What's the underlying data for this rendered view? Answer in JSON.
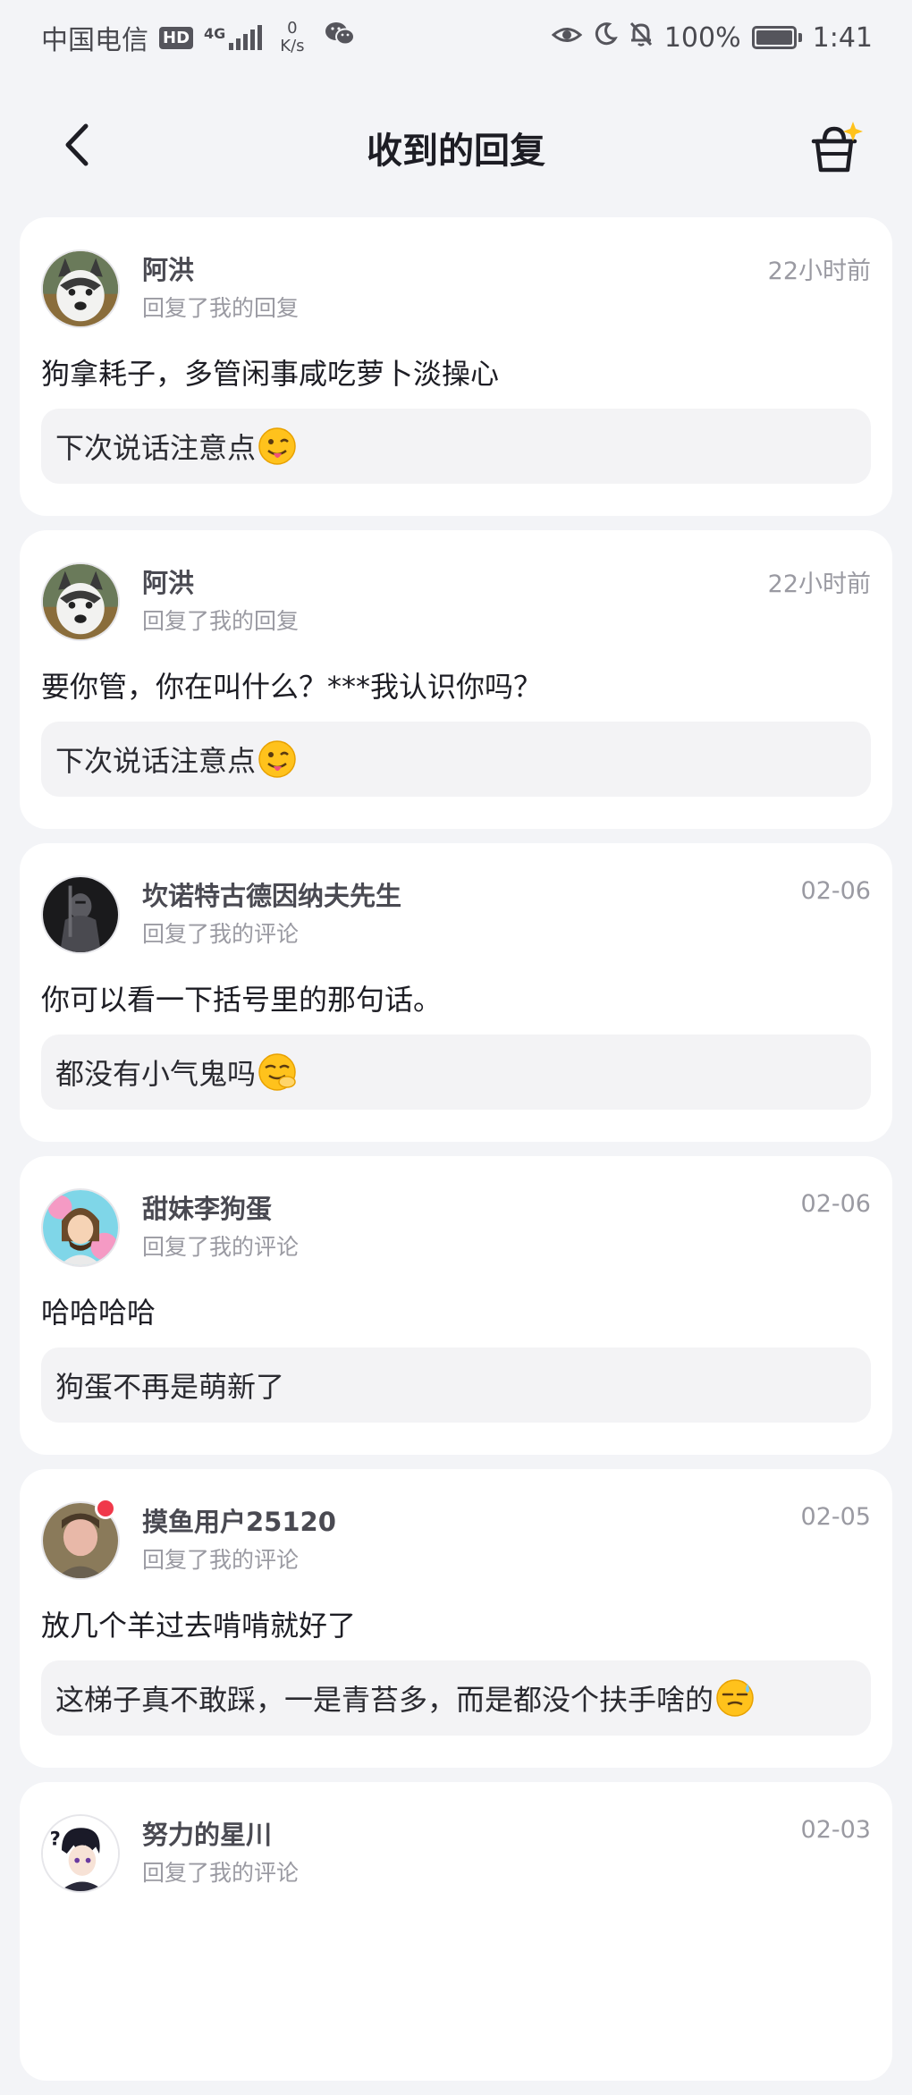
{
  "status_bar": {
    "carrier": "中国电信",
    "hd": "HD",
    "network_gen": "4G",
    "speed_value": "0",
    "speed_unit": "K/s",
    "battery": "100%",
    "time": "1:41",
    "icons": [
      "wechat-icon",
      "eye-icon",
      "moon-icon",
      "bell-muted-icon",
      "battery-icon"
    ]
  },
  "header": {
    "title": "收到的回复",
    "back_icon": "chevron-left-icon",
    "action_icon": "sparkle-basket-icon"
  },
  "replies": [
    {
      "username": "阿洪",
      "action": "回复了我的回复",
      "time": "22小时前",
      "content": "狗拿耗子，多管闲事咸吃萝卜淡操心",
      "quote": "下次说话注意点",
      "emoji": "wink-tongue-emoji",
      "avatar": "husky-avatar"
    },
    {
      "username": "阿洪",
      "action": "回复了我的回复",
      "time": "22小时前",
      "content": "要你管，你在叫什么？***我认识你吗？",
      "quote": "下次说话注意点",
      "emoji": "wink-tongue-emoji",
      "avatar": "husky-avatar"
    },
    {
      "username": "坎诺特古德因纳夫先生",
      "action": "回复了我的评论",
      "time": "02-06",
      "content": "你可以看一下括号里的那句话。",
      "quote": "都没有小气鬼吗",
      "emoji": "sneaky-laugh-emoji",
      "avatar": "knight-avatar"
    },
    {
      "username": "甜妹李狗蛋",
      "action": "回复了我的评论",
      "time": "02-06",
      "content": "哈哈哈哈",
      "quote": "狗蛋不再是萌新了",
      "emoji": "",
      "avatar": "cartoon-avatar"
    },
    {
      "username": "摸鱼用户25120",
      "action": "回复了我的评论",
      "time": "02-05",
      "content": "放几个羊过去啃啃就好了",
      "quote": "这梯子真不敢踩，一是青苔多，而是都没个扶手啥的",
      "emoji": "sweat-smile-emoji",
      "avatar": "photo-avatar",
      "unread_dot": true
    },
    {
      "username": "努力的星川",
      "action": "回复了我的评论",
      "time": "02-03",
      "content": "",
      "quote": "",
      "emoji": "",
      "avatar": "anime-avatar"
    }
  ],
  "colors": {
    "background": "#f3f4f7",
    "card": "#ffffff",
    "quote_bg": "#f3f3f5",
    "accent_yellow": "#ffc21c",
    "unread": "#f0394a"
  }
}
